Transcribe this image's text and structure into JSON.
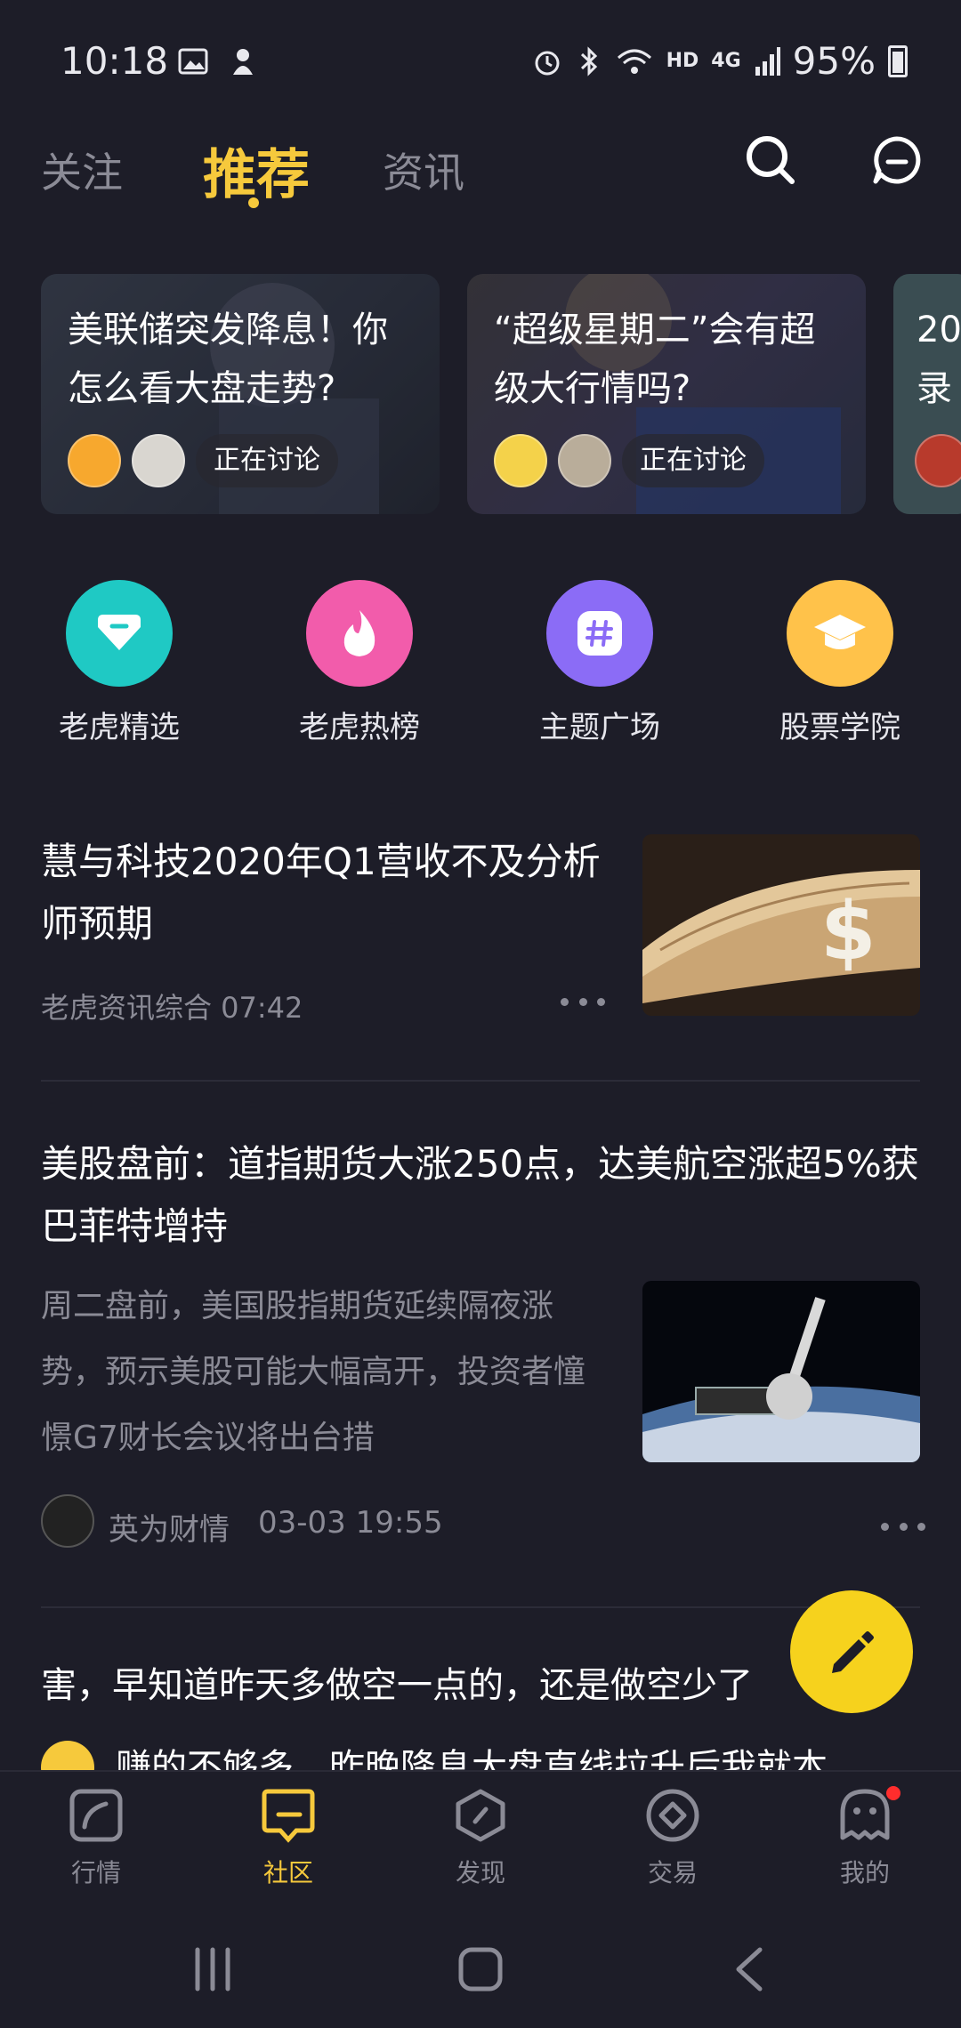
{
  "status_bar": {
    "time": "10:18",
    "network": "HD",
    "signal_label": "4G",
    "battery": "95%"
  },
  "top_tabs": {
    "follow": "关注",
    "recommend": "推荐",
    "news": "资讯"
  },
  "discussion_cards": [
    {
      "title": "美联储突发降息！你怎么看大盘走势?",
      "pill": "正在讨论"
    },
    {
      "title": "“超级星期二”会有超级大行情吗?",
      "pill": "正在讨论"
    },
    {
      "title": "20\n录"
    }
  ],
  "shortcuts": [
    {
      "label": "老虎精选",
      "color": "#1fc9c4"
    },
    {
      "label": "老虎热榜",
      "color": "#f25cab"
    },
    {
      "label": "主题广场",
      "color": "#8b6cf6"
    },
    {
      "label": "股票学院",
      "color": "#ffc24a"
    }
  ],
  "articles": [
    {
      "title": "慧与科技2020年Q1营收不及分析师预期",
      "meta": "老虎资讯综合 07:42"
    },
    {
      "title": "美股盘前：道指期货大涨250点，达美航空涨超5%获巴菲特增持",
      "summary": "周二盘前，美国股指期货延续隔夜涨势，预示美股可能大幅高开，投资者憧憬G7财长会议将出台措",
      "source": "英为财情",
      "time": "03-03 19:55"
    },
    {
      "title": "害，早知道昨天多做空一点的，还是做空少了",
      "summary": "赚的不够多，昨晚降息大盘直线拉升后我就本"
    }
  ],
  "bottom_nav": [
    {
      "label": "行情"
    },
    {
      "label": "社区"
    },
    {
      "label": "发现"
    },
    {
      "label": "交易"
    },
    {
      "label": "我的"
    }
  ],
  "colors": {
    "accent": "#f6c93c",
    "background": "#1d1d28",
    "muted": "#8b8b96"
  }
}
